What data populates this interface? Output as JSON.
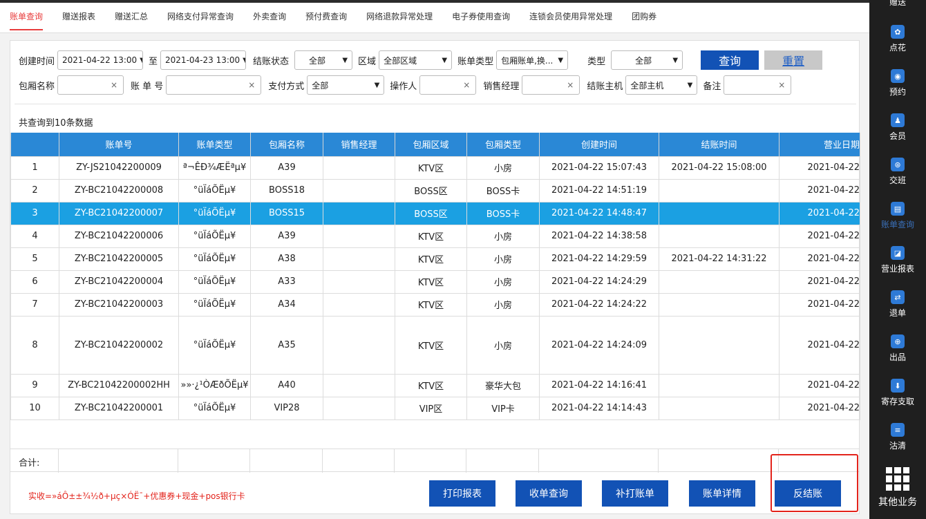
{
  "tabs": [
    {
      "label": "账单查询",
      "active": true
    },
    {
      "label": "赠送报表"
    },
    {
      "label": "赠送汇总"
    },
    {
      "label": "网络支付异常查询"
    },
    {
      "label": "外卖查询"
    },
    {
      "label": "预付费查询"
    },
    {
      "label": "网络退款异常处理"
    },
    {
      "label": "电子券使用查询"
    },
    {
      "label": "连锁会员使用异常处理"
    },
    {
      "label": "团购券"
    }
  ],
  "filters": {
    "created_label": "创建时间",
    "created_from": "2021-04-22 13:00",
    "to_label": "至",
    "created_to": "2021-04-23 13:00",
    "status_label": "结账状态",
    "status_value": "全部",
    "area_label": "区域",
    "area_value": "全部区域",
    "billtype_label": "账单类型",
    "billtype_value": "包厢账单,换...",
    "type_label": "类型",
    "type_value": "全部",
    "query_label": "查询",
    "reset_label": "重置",
    "room_label": "包厢名称",
    "billno_label": "账 单 号",
    "pay_label": "支付方式",
    "pay_value": "全部",
    "operator_label": "操作人",
    "manager_label": "销售经理",
    "host_label": "结账主机",
    "host_value": "全部主机",
    "remark_label": "备注",
    "clear_glyph": "×",
    "arrow_glyph": "▼"
  },
  "count_text": "共查询到10条数据",
  "columns": [
    "",
    "账单号",
    "账单类型",
    "包厢名称",
    "销售经理",
    "包厢区域",
    "包厢类型",
    "创建时间",
    "结账时间",
    "营业日期"
  ],
  "rows": [
    {
      "idx": "1",
      "no": "ZY-JS21042200009",
      "type": "ª¬ÊÐ¾ÆËªµ¥",
      "room": "A39",
      "mgr": "",
      "area": "KTV区",
      "rtype": "小房",
      "created": "2021-04-22 15:07:43",
      "closed": "2021-04-22 15:08:00",
      "bizdate": "2021-04-22"
    },
    {
      "idx": "2",
      "no": "ZY-BC21042200008",
      "type": "°üÏáÕËµ¥",
      "room": "BOSS18",
      "mgr": "",
      "area": "BOSS区",
      "rtype": "BOSS卡",
      "created": "2021-04-22 14:51:19",
      "closed": "",
      "bizdate": "2021-04-22"
    },
    {
      "idx": "3",
      "no": "ZY-BC21042200007",
      "type": "°üÏáÕËµ¥",
      "room": "BOSS15",
      "mgr": "",
      "area": "BOSS区",
      "rtype": "BOSS卡",
      "created": "2021-04-22 14:48:47",
      "closed": "",
      "bizdate": "2021-04-22",
      "selected": true
    },
    {
      "idx": "4",
      "no": "ZY-BC21042200006",
      "type": "°üÏáÕËµ¥",
      "room": "A39",
      "mgr": "",
      "area": "KTV区",
      "rtype": "小房",
      "created": "2021-04-22 14:38:58",
      "closed": "",
      "bizdate": "2021-04-22"
    },
    {
      "idx": "5",
      "no": "ZY-BC21042200005",
      "type": "°üÏáÕËµ¥",
      "room": "A38",
      "mgr": "",
      "area": "KTV区",
      "rtype": "小房",
      "created": "2021-04-22 14:29:59",
      "closed": "2021-04-22 14:31:22",
      "bizdate": "2021-04-22"
    },
    {
      "idx": "6",
      "no": "ZY-BC21042200004",
      "type": "°üÏáÕËµ¥",
      "room": "A33",
      "mgr": "",
      "area": "KTV区",
      "rtype": "小房",
      "created": "2021-04-22 14:24:29",
      "closed": "",
      "bizdate": "2021-04-22"
    },
    {
      "idx": "7",
      "no": "ZY-BC21042200003",
      "type": "°üÏáÕËµ¥",
      "room": "A34",
      "mgr": "",
      "area": "KTV区",
      "rtype": "小房",
      "created": "2021-04-22 14:24:22",
      "closed": "",
      "bizdate": "2021-04-22"
    },
    {
      "idx": "8",
      "no": "ZY-BC21042200002",
      "type": "°üÏáÕËµ¥",
      "room": "A35",
      "mgr": "",
      "area": "KTV区",
      "rtype": "小房",
      "created": "2021-04-22 14:24:09",
      "closed": "",
      "bizdate": "2021-04-22",
      "tall": true
    },
    {
      "idx": "9",
      "no": "ZY-BC21042200002HH",
      "type": "»»·¿¹ÒÆðÕËµ¥",
      "room": "A40",
      "mgr": "",
      "area": "KTV区",
      "rtype": "豪华大包",
      "created": "2021-04-22 14:16:41",
      "closed": "",
      "bizdate": "2021-04-22"
    },
    {
      "idx": "10",
      "no": "ZY-BC21042200001",
      "type": "°üÏáÕËµ¥",
      "room": "VIP28",
      "mgr": "",
      "area": "VIP区",
      "rtype": "VIP卡",
      "created": "2021-04-22 14:14:43",
      "closed": "",
      "bizdate": "2021-04-22"
    }
  ],
  "total_label": "合计:",
  "note": "实收=»áÔ±±¾½ð+µç×ÓË¯+优惠券+现金+pos银行卡",
  "actions": {
    "print": "打印报表",
    "receipt": "收单查询",
    "reprint": "补打账单",
    "detail": "账单详情",
    "unsettle": "反结账"
  },
  "sidebar": [
    {
      "label": "赠送",
      "icon": "gift-icon"
    },
    {
      "label": "点花",
      "icon": "flower-icon",
      "glyph": "✿"
    },
    {
      "label": "预约",
      "icon": "reserve-icon",
      "glyph": "◉"
    },
    {
      "label": "会员",
      "icon": "member-icon",
      "glyph": "♟"
    },
    {
      "label": "交班",
      "icon": "shift-icon",
      "glyph": "⊛"
    },
    {
      "label": "账单查询",
      "icon": "bill-icon",
      "glyph": "▤",
      "active": true
    },
    {
      "label": "营业报表",
      "icon": "report-icon",
      "glyph": "◪"
    },
    {
      "label": "退单",
      "icon": "refund-icon",
      "glyph": "⇄"
    },
    {
      "label": "出品",
      "icon": "output-icon",
      "glyph": "⊕"
    },
    {
      "label": "寄存支取",
      "icon": "deposit-icon",
      "glyph": "⬇"
    },
    {
      "label": "沽清",
      "icon": "soldout-icon",
      "glyph": "≡"
    },
    {
      "label": "其他业务",
      "icon": "more-grid-icon"
    }
  ],
  "colors": {
    "accent": "#1252b5",
    "selected_row": "#1ba0e2",
    "header": "#2a88d6",
    "alert": "#e3231b"
  }
}
